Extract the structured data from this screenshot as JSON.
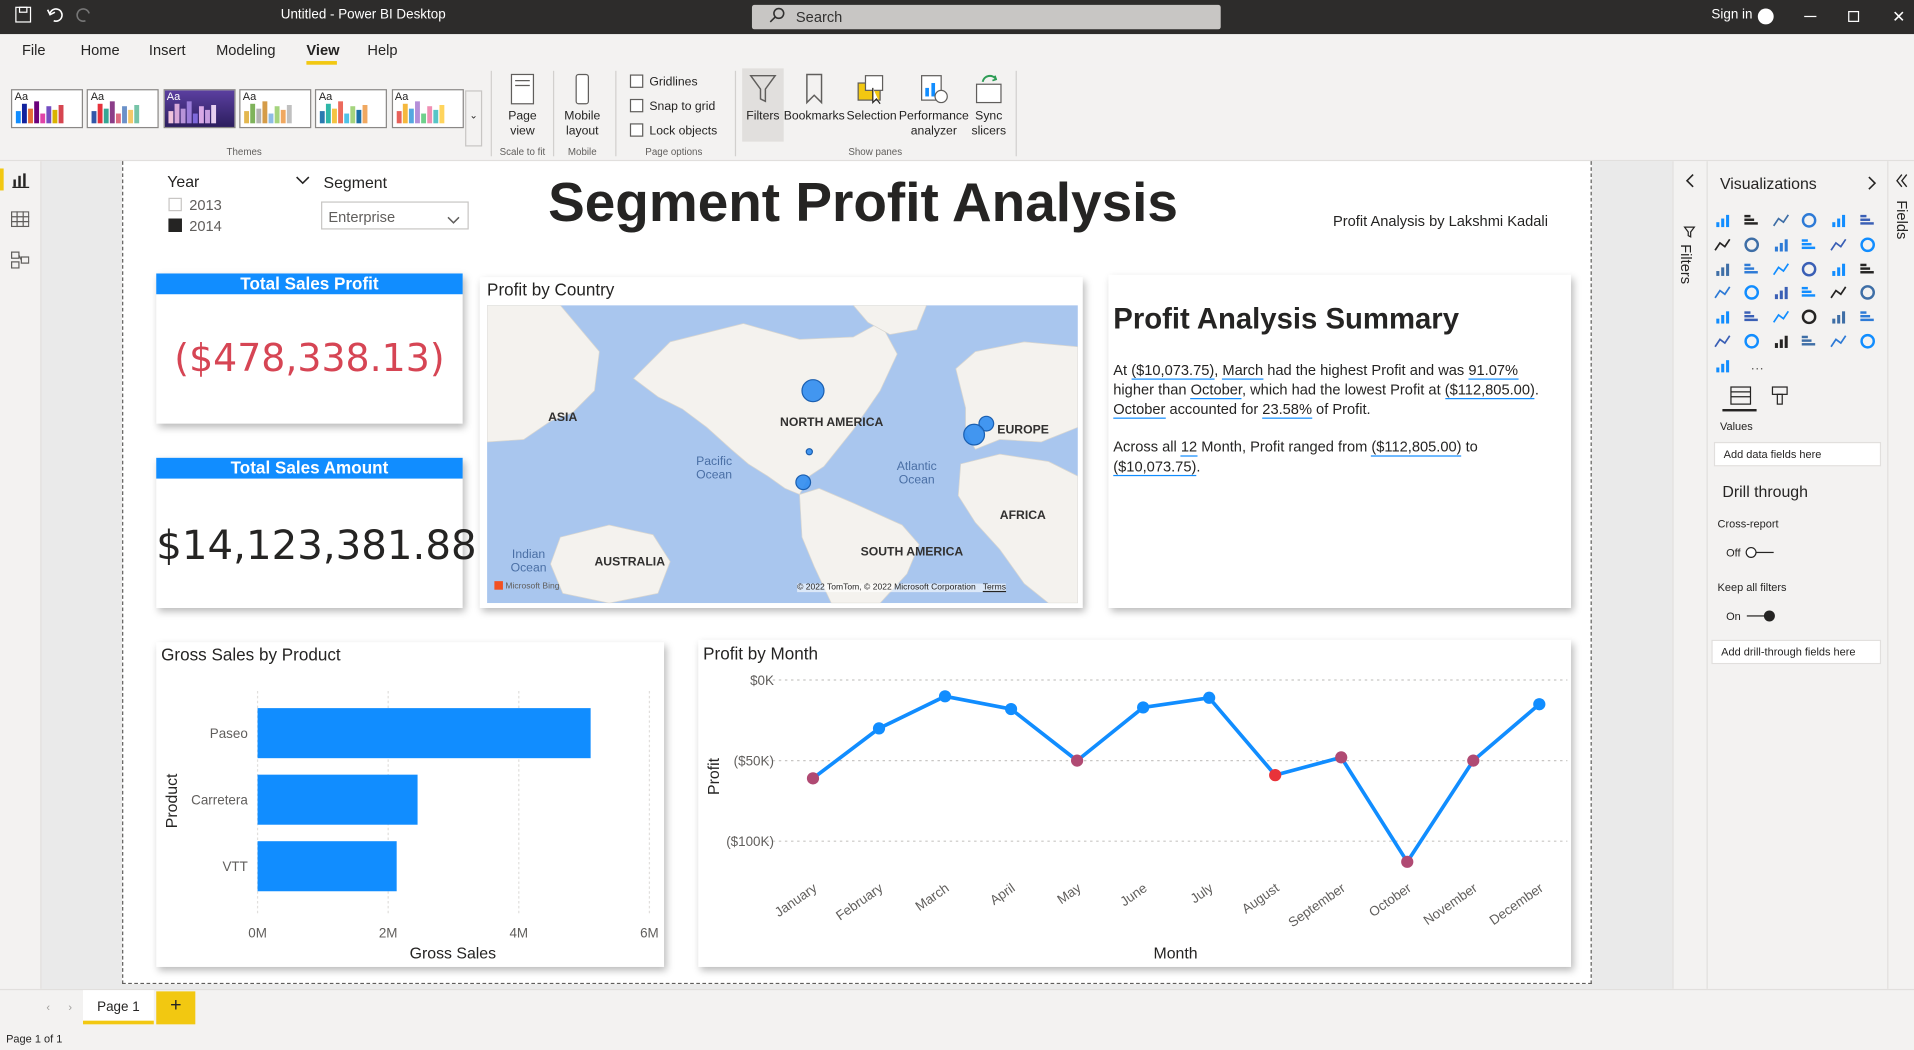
{
  "window": {
    "title": "Untitled - Power BI Desktop",
    "search_placeholder": "Search",
    "sign_in": "Sign in"
  },
  "menu": [
    "File",
    "Home",
    "Insert",
    "Modeling",
    "View",
    "Help"
  ],
  "active_menu": "View",
  "ribbon": {
    "themes_label": "Themes",
    "theme_aa": "Aa",
    "page_view_label": "Page view",
    "scale_to_fit_label": "Scale to fit",
    "mobile_layout_label": "Mobile layout",
    "mobile_label": "Mobile",
    "gridlines": "Gridlines",
    "snap_to_grid": "Snap to grid",
    "lock_objects": "Lock objects",
    "page_options_label": "Page options",
    "show_panes": [
      "Filters",
      "Bookmarks",
      "Selection",
      "Performance analyzer",
      "Sync slicers"
    ],
    "show_panes_label": "Show panes"
  },
  "report": {
    "year_slicer": {
      "title": "Year",
      "options": [
        "2013",
        "2014"
      ],
      "checked": [
        false,
        true
      ]
    },
    "segment_slicer": {
      "title": "Segment",
      "value": "Enterprise"
    },
    "title": "Segment Profit Analysis",
    "author": "Profit Analysis by Lakshmi Kadali",
    "kpi_profit": {
      "label": "Total Sales Profit",
      "value": "($478,338.13)",
      "color": "#d64554"
    },
    "kpi_amount": {
      "label": "Total Sales Amount",
      "value": "$14,123,381.88",
      "color": "#252423"
    },
    "map": {
      "title": "Profit by Country",
      "labels": [
        "ASIA",
        "NORTH AMERICA",
        "EUROPE",
        "AFRICA",
        "SOUTH AMERICA",
        "AUSTRALIA"
      ],
      "ocean_labels": [
        "Pacific Ocean",
        "Atlantic Ocean",
        "Indian Ocean"
      ],
      "attribution": "© 2022 TomTom, © 2022 Microsoft Corporation",
      "terms": "Terms",
      "bing": "Microsoft Bing"
    },
    "summary": {
      "title": "Profit Analysis Summary",
      "p1": [
        "At ",
        "($10,073.75)",
        ", ",
        "March",
        " had the highest Profit and was ",
        "91.07%",
        " higher than ",
        "October",
        ", which had the lowest Profit at ",
        "($112,805.00)",
        ". ",
        "October",
        " accounted for ",
        "23.58%",
        " of Profit."
      ],
      "p2": [
        "Across all ",
        "12",
        " Month, Profit ranged from ",
        "($112,805.00)",
        " to ",
        "($10,073.75)",
        "."
      ]
    }
  },
  "chart_data": [
    {
      "type": "bar",
      "orientation": "horizontal",
      "title": "Gross Sales by Product",
      "categories": [
        "Paseo",
        "Carretera",
        "VTT"
      ],
      "values": [
        5.1,
        2.45,
        2.13
      ],
      "xlabel": "Gross Sales",
      "ylabel": "Product",
      "xticks": [
        "0M",
        "2M",
        "4M",
        "6M"
      ],
      "xlim": [
        0,
        6
      ],
      "unit": "M",
      "color": "#118dff",
      "grid": true
    },
    {
      "type": "line",
      "title": "Profit by Month",
      "categories": [
        "January",
        "February",
        "March",
        "April",
        "May",
        "June",
        "July",
        "August",
        "September",
        "October",
        "November",
        "December"
      ],
      "values": [
        -61,
        -30,
        -10.1,
        -18,
        -50,
        -17,
        -11,
        -59,
        -48,
        -112.8,
        -50,
        -15
      ],
      "xlabel": "Month",
      "ylabel": "Profit",
      "yticks": [
        "$0K",
        "($50K)",
        "($100K)"
      ],
      "ylim": [
        -125,
        0
      ],
      "unit": "K",
      "line_color": "#118dff",
      "negative_marker_color": "#b04a73",
      "min_marker_color": "#e8333a",
      "grid": true
    }
  ],
  "viz_pane": {
    "title": "Visualizations",
    "filters_label": "Filters",
    "fields_label": "Fields",
    "values_label": "Values",
    "add_data_fields": "Add data fields here",
    "drill_through": "Drill through",
    "cross_report": "Cross-report",
    "off": "Off",
    "keep_all_filters": "Keep all filters",
    "on": "On",
    "add_drill": "Add drill-through fields here",
    "more": "···"
  },
  "tabs": {
    "page1": "Page 1",
    "add": "+"
  },
  "status": "Page 1 of 1"
}
